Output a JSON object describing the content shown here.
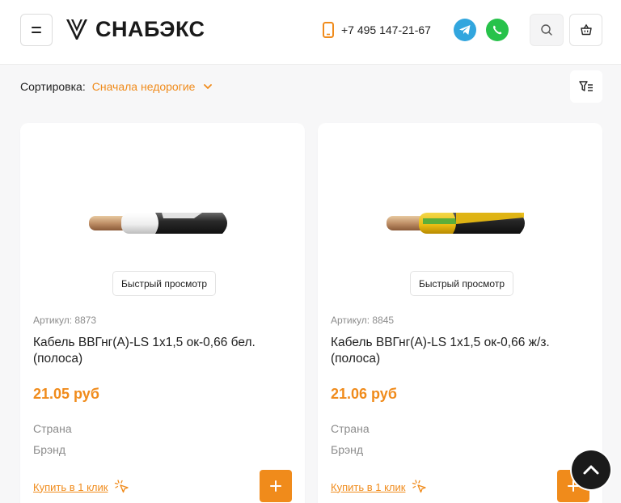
{
  "header": {
    "logo_text": "СНАБЭКС",
    "phone": "+7 495 147-21-67"
  },
  "sort": {
    "label": "Сортировка:",
    "value": "Сначала недорогие"
  },
  "products": [
    {
      "quick_view": "Быстрый просмотр",
      "sku": "Артикул: 8873",
      "title": "Кабель ВВГнг(А)-LS 1х1,5 ок-0,66 бел. (полоса)",
      "price": "21.05 руб",
      "country_label": "Страна",
      "brand_label": "Брэнд",
      "one_click": "Купить в 1 клик",
      "sheath_color": "white"
    },
    {
      "quick_view": "Быстрый просмотр",
      "sku": "Артикул: 8845",
      "title": "Кабель ВВГнг(А)-LS 1х1,5 ок-0,66 ж/з. (полоса)",
      "price": "21.06 руб",
      "country_label": "Страна",
      "brand_label": "Брэнд",
      "one_click": "Купить в 1 клик",
      "sheath_color": "yellow-green"
    }
  ],
  "colors": {
    "accent": "#f08b1b",
    "telegram": "#32a6de",
    "whatsapp": "#27c24a"
  }
}
